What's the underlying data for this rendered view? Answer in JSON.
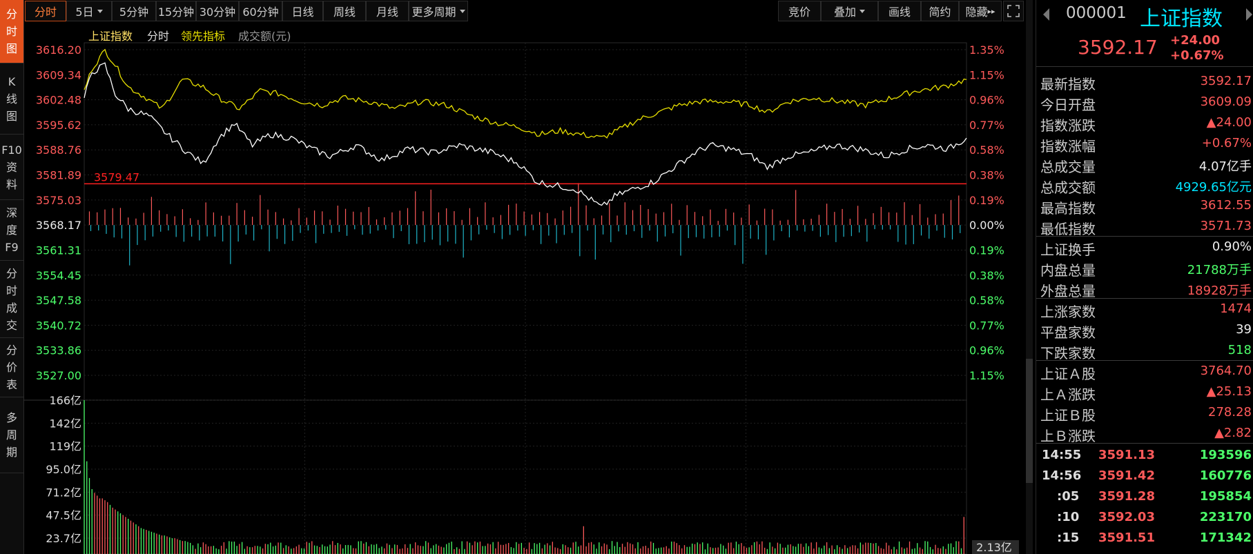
{
  "left_tabs": [
    {
      "chars": [
        "分",
        "时",
        "图"
      ],
      "active": true
    },
    {
      "chars": [
        "K",
        "线",
        "图"
      ],
      "active": false
    },
    {
      "chars": [
        "F10",
        "资",
        "料"
      ],
      "active": false
    },
    {
      "chars": [
        "深",
        "度",
        "F9"
      ],
      "active": false
    },
    {
      "chars": [
        "分",
        "时",
        "成",
        "交"
      ],
      "active": false
    },
    {
      "chars": [
        "分",
        "价",
        "表"
      ],
      "active": false
    },
    {
      "chars": [
        "多",
        "周",
        "期"
      ],
      "active": false
    }
  ],
  "toolbar": {
    "periods": [
      "分时",
      "5日",
      "5分钟",
      "15分钟",
      "30分钟",
      "60分钟",
      "日线",
      "周线",
      "月线",
      "更多周期"
    ],
    "right": [
      "竞价",
      "叠加",
      "画线",
      "简约",
      "隐藏"
    ]
  },
  "legend": {
    "index": "上证指数",
    "mode": "分时",
    "lead": "领先指标",
    "amount": "成交额(元)"
  },
  "colors": {
    "price_line": "#ffffff",
    "lead_line": "#e8e000",
    "up": "#ff5a5a",
    "down": "#4cff6a",
    "cyan_bar": "#1fb5c9",
    "ref_line": "#ff2020"
  },
  "chart_data": {
    "type": "line",
    "prev_close": 3568.17,
    "ref_line_label": "3579.47",
    "price_ylim": [
      3527.0,
      3616.2
    ],
    "price_ticks": [
      "3616.20",
      "3609.34",
      "3602.48",
      "3595.62",
      "3588.76",
      "3581.89",
      "3575.03",
      "3568.17",
      "3561.31",
      "3554.45",
      "3547.58",
      "3540.72",
      "3533.86",
      "3527.00"
    ],
    "pct_ticks": [
      "1.35%",
      "1.15%",
      "0.96%",
      "0.77%",
      "0.58%",
      "0.38%",
      "0.19%",
      "0.00%",
      "0.19%",
      "0.38%",
      "0.58%",
      "0.77%",
      "0.96%",
      "1.15%"
    ],
    "price_series_key": [
      [
        0,
        3603
      ],
      [
        3,
        3610
      ],
      [
        8,
        3612
      ],
      [
        12,
        3604
      ],
      [
        17,
        3600
      ],
      [
        25,
        3598
      ],
      [
        32,
        3593
      ],
      [
        40,
        3588
      ],
      [
        46,
        3585
      ],
      [
        52,
        3592
      ],
      [
        58,
        3596
      ],
      [
        65,
        3590
      ],
      [
        72,
        3593
      ],
      [
        80,
        3592
      ],
      [
        88,
        3589
      ],
      [
        95,
        3587
      ],
      [
        105,
        3590
      ],
      [
        115,
        3586
      ],
      [
        125,
        3589
      ],
      [
        135,
        3588
      ],
      [
        145,
        3590
      ],
      [
        158,
        3588
      ],
      [
        168,
        3585
      ],
      [
        175,
        3580
      ],
      [
        182,
        3579
      ],
      [
        190,
        3578
      ],
      [
        196,
        3575
      ],
      [
        200,
        3573
      ],
      [
        205,
        3576
      ],
      [
        212,
        3578
      ],
      [
        220,
        3580
      ],
      [
        228,
        3584
      ],
      [
        236,
        3588
      ],
      [
        242,
        3590
      ],
      [
        250,
        3589
      ],
      [
        258,
        3587
      ],
      [
        264,
        3584
      ],
      [
        272,
        3587
      ],
      [
        280,
        3588
      ],
      [
        290,
        3590
      ],
      [
        300,
        3589
      ],
      [
        310,
        3587
      ],
      [
        318,
        3589
      ],
      [
        326,
        3590
      ],
      [
        334,
        3589
      ],
      [
        341,
        3592
      ]
    ],
    "lead_series_key": [
      [
        0,
        3605
      ],
      [
        3,
        3611
      ],
      [
        8,
        3616
      ],
      [
        12,
        3612
      ],
      [
        17,
        3606
      ],
      [
        24,
        3603
      ],
      [
        30,
        3600
      ],
      [
        38,
        3608
      ],
      [
        46,
        3606
      ],
      [
        52,
        3603
      ],
      [
        60,
        3600
      ],
      [
        68,
        3605
      ],
      [
        76,
        3604
      ],
      [
        84,
        3602
      ],
      [
        92,
        3601
      ],
      [
        100,
        3603
      ],
      [
        110,
        3602
      ],
      [
        120,
        3600
      ],
      [
        130,
        3602
      ],
      [
        140,
        3601
      ],
      [
        150,
        3598
      ],
      [
        160,
        3596
      ],
      [
        168,
        3595
      ],
      [
        176,
        3593
      ],
      [
        184,
        3594
      ],
      [
        192,
        3593
      ],
      [
        200,
        3592
      ],
      [
        206,
        3594
      ],
      [
        214,
        3597
      ],
      [
        222,
        3599
      ],
      [
        230,
        3601
      ],
      [
        238,
        3602
      ],
      [
        248,
        3602
      ],
      [
        258,
        3601
      ],
      [
        264,
        3599
      ],
      [
        272,
        3602
      ],
      [
        282,
        3603
      ],
      [
        292,
        3602
      ],
      [
        302,
        3601
      ],
      [
        312,
        3603
      ],
      [
        322,
        3605
      ],
      [
        332,
        3606
      ],
      [
        341,
        3608
      ]
    ],
    "volume_ticks": [
      "166亿",
      "142亿",
      "119亿",
      "95.0亿",
      "71.2亿",
      "47.5亿",
      "23.7亿"
    ],
    "volume_ylim": [
      0,
      166
    ],
    "volume_last_label": "2.13亿",
    "volume_head": [
      166,
      100,
      82,
      70,
      66,
      63,
      60,
      60,
      58,
      56,
      53,
      50,
      48,
      46,
      44,
      42,
      40,
      38,
      36,
      34,
      32,
      30,
      28,
      27,
      26,
      25,
      24,
      23,
      22,
      21,
      20,
      20,
      19,
      18,
      17,
      17,
      16,
      15,
      14,
      14,
      13,
      12
    ],
    "volume_tail": 10,
    "volume_last": 40
  },
  "quote": {
    "code": "000001",
    "name": "上证指数",
    "price": "3592.17",
    "change": "+24.00",
    "change_pct": "+0.67%",
    "rows1": [
      {
        "k": "最新指数",
        "v": "3592.17",
        "c": "red"
      },
      {
        "k": "今日开盘",
        "v": "3609.09",
        "c": "red"
      },
      {
        "k": "指数涨跌",
        "v": "▲24.00",
        "c": "red"
      },
      {
        "k": "指数涨幅",
        "v": "+0.67%",
        "c": "red"
      },
      {
        "k": "总成交量",
        "v": "4.07亿手",
        "c": "white"
      },
      {
        "k": "总成交额",
        "v": "4929.65亿元",
        "c": "cyan"
      },
      {
        "k": "最高指数",
        "v": "3612.55",
        "c": "red"
      },
      {
        "k": "最低指数",
        "v": "3571.73",
        "c": "red"
      }
    ],
    "rows2": [
      {
        "k": "上证换手",
        "v": "0.90%",
        "c": "white"
      },
      {
        "k": "内盘总量",
        "v": "21788万手",
        "c": "green"
      },
      {
        "k": "外盘总量",
        "v": "18928万手",
        "c": "red"
      }
    ],
    "rows3": [
      {
        "k": "上涨家数",
        "v": "1474",
        "c": "red"
      },
      {
        "k": "平盘家数",
        "v": "39",
        "c": "white"
      },
      {
        "k": "下跌家数",
        "v": "518",
        "c": "green"
      }
    ],
    "rows4": [
      {
        "k": "上证Ａ股",
        "v": "3764.70",
        "c": "red"
      },
      {
        "k": "上Ａ涨跌",
        "v": "▲25.13",
        "c": "red"
      },
      {
        "k": "上证Ｂ股",
        "v": "278.28",
        "c": "red"
      },
      {
        "k": "上Ｂ涨跌",
        "v": "▲2.82",
        "c": "red"
      }
    ],
    "ticks": [
      {
        "t": "14:55",
        "p": "3591.13",
        "n": "193596"
      },
      {
        "t": "14:56",
        "p": "3591.42",
        "n": "160776"
      },
      {
        "t": ":05",
        "p": "3591.28",
        "n": "195854"
      },
      {
        "t": ":10",
        "p": "3592.03",
        "n": "223170"
      },
      {
        "t": ":15",
        "p": "3591.51",
        "n": "171342"
      }
    ]
  }
}
